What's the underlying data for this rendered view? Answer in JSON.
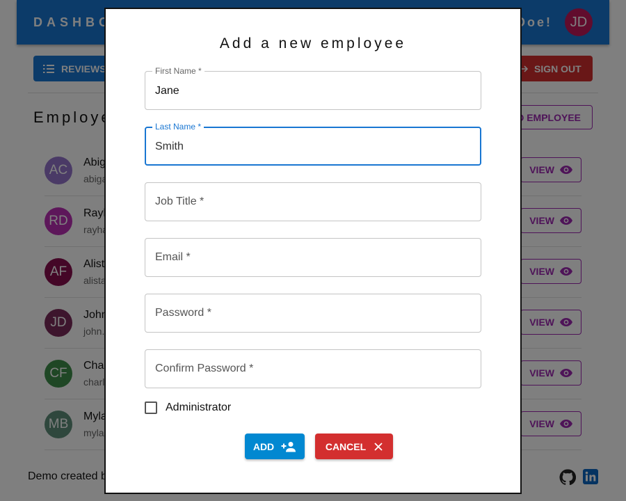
{
  "appbar": {
    "title": "DASHBOARD",
    "greeting": "John Doe!",
    "avatar_initials": "JD",
    "color": "#1976d2"
  },
  "toolbar": {
    "reviews_label": "REVIEWS",
    "signout_label": "SIGN OUT"
  },
  "employees_section": {
    "title": "Employees",
    "add_button_label": "ADD EMPLOYEE",
    "view_label": "VIEW",
    "rows": [
      {
        "initials": "AC",
        "name": "Abigail Clark",
        "email": "abigail.clark@example.com",
        "color": "#9575cd"
      },
      {
        "initials": "RD",
        "name": "Rayhan Dixon",
        "email": "rayhan.dixon@example.com",
        "color": "#ba2fb5"
      },
      {
        "initials": "AF",
        "name": "Alistair Fox",
        "email": "alistair.fox@example.com",
        "color": "#880e4f"
      },
      {
        "initials": "JD",
        "name": "John Doe",
        "email": "john.doe@example.com",
        "color": "#7b2a5a"
      },
      {
        "initials": "CF",
        "name": "Charlie Ford",
        "email": "charlie.ford@example.com",
        "color": "#3f8f4a"
      },
      {
        "initials": "MB",
        "name": "Myla Brooks",
        "email": "myla.brooks@example.com",
        "color": "#5e8f7a"
      }
    ]
  },
  "footer": {
    "text": "Demo created by"
  },
  "dialog": {
    "title": "Add a new employee",
    "fields": {
      "first_name": {
        "label": "First Name *",
        "value": "Jane"
      },
      "last_name": {
        "label": "Last Name *",
        "value": "Smith"
      },
      "job_title": {
        "placeholder": "Job Title *"
      },
      "email": {
        "placeholder": "Email *"
      },
      "password": {
        "placeholder": "Password *"
      },
      "confirm_password": {
        "placeholder": "Confirm Password *"
      }
    },
    "administrator_label": "Administrator",
    "administrator_checked": false,
    "add_label": "ADD",
    "cancel_label": "CANCEL"
  }
}
